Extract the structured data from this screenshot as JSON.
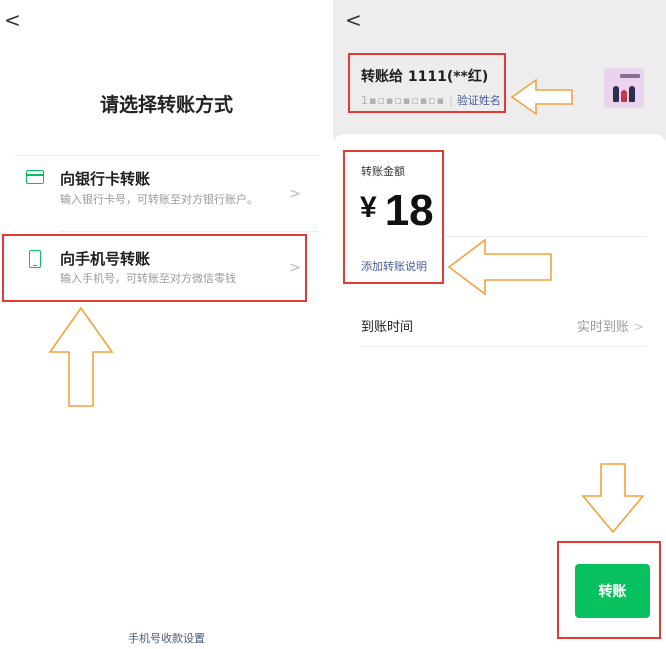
{
  "left": {
    "back_glyph": "<",
    "title": "请选择转账方式",
    "options": [
      {
        "title": "向银行卡转账",
        "desc": "输入银行卡号，可转账至对方银行账户。",
        "icon": "bank-card-icon"
      },
      {
        "title": "向手机号转账",
        "desc": "输入手机号，可转账至对方微信零钱",
        "icon": "mobile-phone-icon"
      }
    ],
    "chevron": ">",
    "footer_link": "手机号收款设置"
  },
  "right": {
    "back_glyph": "<",
    "payee": {
      "name": "转账给 1111(**红)",
      "masked_account": "1",
      "verify_label": "验证姓名"
    },
    "amount_label": "转账金额",
    "currency": "¥",
    "amount": "18",
    "add_note": "添加转账说明",
    "arrive_label": "到账时间",
    "arrive_value": "实时到账",
    "chevron": ">",
    "submit_label": "转账"
  },
  "colors": {
    "accent_green": "#07c160",
    "highlight_red": "#e53935",
    "arrow_orange": "#f5a23c",
    "link_blue": "#4b5b9a"
  }
}
